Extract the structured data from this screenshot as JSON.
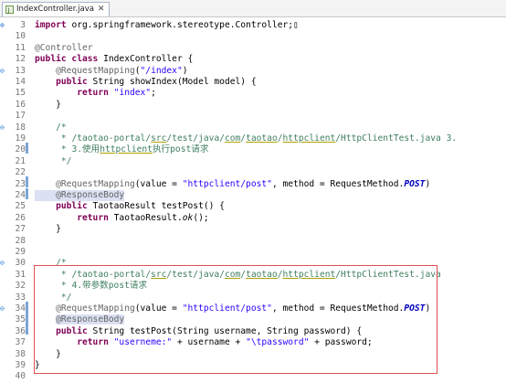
{
  "tab": {
    "title": "IndexController.java",
    "close_glyph": "✕"
  },
  "lines": [
    {
      "n": "3",
      "mk": "⊕",
      "t": [
        [
          "k",
          "import "
        ],
        [
          "",
          "org.springframework.stereotype.Controller;▯"
        ]
      ]
    },
    {
      "n": "10",
      "t": []
    },
    {
      "n": "11",
      "t": [
        [
          "a",
          "@Controller"
        ]
      ]
    },
    {
      "n": "12",
      "t": [
        [
          "k",
          "public class "
        ],
        [
          "",
          "IndexController {"
        ]
      ]
    },
    {
      "n": "13",
      "mk": "⊖",
      "t": [
        [
          "",
          "    "
        ],
        [
          "a",
          "@RequestMapping"
        ],
        [
          "",
          "("
        ],
        [
          "s",
          "\"/index\""
        ],
        [
          "",
          ")"
        ]
      ]
    },
    {
      "n": "14",
      "t": [
        [
          "",
          "    "
        ],
        [
          "k",
          "public "
        ],
        [
          "",
          "String showIndex(Model model) {"
        ]
      ]
    },
    {
      "n": "15",
      "t": [
        [
          "",
          "        "
        ],
        [
          "k",
          "return "
        ],
        [
          "s",
          "\"index\""
        ],
        [
          "",
          ";"
        ]
      ]
    },
    {
      "n": "16",
      "t": [
        [
          "",
          "    }"
        ]
      ]
    },
    {
      "n": "17",
      "t": []
    },
    {
      "n": "18",
      "mk": "⊖",
      "t": [
        [
          "",
          "    "
        ],
        [
          "c",
          "/*"
        ]
      ]
    },
    {
      "n": "19",
      "t": [
        [
          "",
          "     "
        ],
        [
          "c",
          "* /taotao-portal/"
        ],
        [
          "cu",
          "src"
        ],
        [
          "c",
          "/test/java/"
        ],
        [
          "cu",
          "com"
        ],
        [
          "c",
          "/"
        ],
        [
          "cu",
          "taotao"
        ],
        [
          "c",
          "/"
        ],
        [
          "cu",
          "httpclient"
        ],
        [
          "c",
          "/HttpClientTest.java 3."
        ]
      ]
    },
    {
      "n": "20",
      "t": [
        [
          "",
          "     "
        ],
        [
          "c",
          "* 3.使用"
        ],
        [
          "cu",
          "httpclient"
        ],
        [
          "c",
          "执行post请求"
        ]
      ]
    },
    {
      "n": "21",
      "t": [
        [
          "",
          "     "
        ],
        [
          "c",
          "*/"
        ]
      ]
    },
    {
      "n": "22",
      "t": []
    },
    {
      "n": "23",
      "t": [
        [
          "",
          "    "
        ],
        [
          "a",
          "@RequestMapping"
        ],
        [
          "",
          "(value = "
        ],
        [
          "s",
          "\"httpclient/post\""
        ],
        [
          "",
          ", method = RequestMethod."
        ],
        [
          "fi",
          "POST"
        ],
        [
          "",
          ")"
        ]
      ]
    },
    {
      "n": "24",
      "hl": true,
      "t": [
        [
          "",
          "    "
        ],
        [
          "a",
          "@ResponseBody"
        ]
      ]
    },
    {
      "n": "25",
      "t": [
        [
          "",
          "    "
        ],
        [
          "k",
          "public "
        ],
        [
          "",
          "TaotaoResult testPost() {"
        ]
      ]
    },
    {
      "n": "26",
      "t": [
        [
          "",
          "        "
        ],
        [
          "k",
          "return "
        ],
        [
          "",
          "TaotaoResult."
        ],
        [
          "it",
          "ok"
        ],
        [
          "",
          "();"
        ]
      ]
    },
    {
      "n": "27",
      "t": [
        [
          "",
          "    }"
        ]
      ]
    },
    {
      "n": "28",
      "t": []
    },
    {
      "n": "29",
      "t": []
    },
    {
      "n": "30",
      "mk": "⊖",
      "t": [
        [
          "",
          "    "
        ],
        [
          "c",
          "/*"
        ]
      ]
    },
    {
      "n": "31",
      "t": [
        [
          "",
          "     "
        ],
        [
          "c",
          "* /taotao-portal/"
        ],
        [
          "cu",
          "src"
        ],
        [
          "c",
          "/test/java/"
        ],
        [
          "cu",
          "com"
        ],
        [
          "c",
          "/"
        ],
        [
          "cu",
          "taotao"
        ],
        [
          "c",
          "/"
        ],
        [
          "cu",
          "httpclient"
        ],
        [
          "c",
          "/HttpClientTest.java"
        ]
      ]
    },
    {
      "n": "32",
      "t": [
        [
          "",
          "     "
        ],
        [
          "c",
          "* 4.带参数post请求"
        ]
      ]
    },
    {
      "n": "33",
      "t": [
        [
          "",
          "     "
        ],
        [
          "c",
          "*/"
        ]
      ]
    },
    {
      "n": "34",
      "mk": "⊖",
      "t": [
        [
          "",
          "    "
        ],
        [
          "a",
          "@RequestMapping"
        ],
        [
          "",
          "(value = "
        ],
        [
          "s",
          "\"httpclient/post\""
        ],
        [
          "",
          ", method = RequestMethod."
        ],
        [
          "fi",
          "POST"
        ],
        [
          "",
          ")"
        ]
      ]
    },
    {
      "n": "35",
      "t": [
        [
          "",
          "    "
        ],
        [
          "ah",
          "@ResponseBody"
        ]
      ]
    },
    {
      "n": "36",
      "t": [
        [
          "",
          "    "
        ],
        [
          "k",
          "public "
        ],
        [
          "",
          "String testPost(String username, String password) {"
        ]
      ]
    },
    {
      "n": "37",
      "t": [
        [
          "",
          "        "
        ],
        [
          "k",
          "return "
        ],
        [
          "s",
          "\"userneme:\""
        ],
        [
          "",
          " + username + "
        ],
        [
          "s",
          "\"\\tpassword\""
        ],
        [
          "",
          " + password;"
        ]
      ]
    },
    {
      "n": "38",
      "t": [
        [
          "",
          "    }"
        ]
      ]
    },
    {
      "n": "39",
      "t": [
        [
          "",
          "}"
        ]
      ]
    },
    {
      "n": "40",
      "t": []
    }
  ]
}
